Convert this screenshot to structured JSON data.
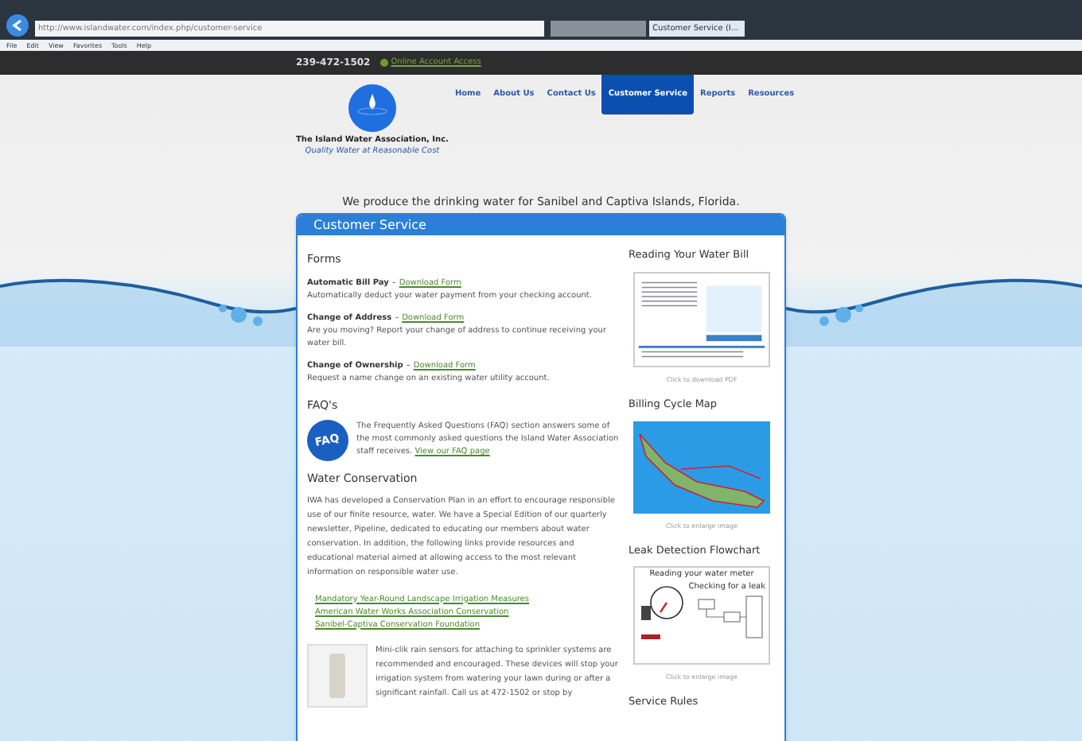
{
  "browser": {
    "url": "http://www.islandwater.com/index.php/customer-service",
    "tabs": [
      {
        "selected": false
      },
      {
        "label": "Customer Service (I...",
        "selected": true
      }
    ],
    "menu": [
      "File",
      "Edit",
      "View",
      "Favorites",
      "Tools",
      "Help"
    ]
  },
  "site": {
    "phone": "239-472-1502",
    "account_link": "Online Account Access",
    "logo": {
      "name": "The Island Water Association, Inc.",
      "tagline": "Quality Water at Reasonable Cost"
    },
    "nav": [
      {
        "label": "Home",
        "selected": false
      },
      {
        "label": "About Us",
        "selected": false
      },
      {
        "label": "Contact Us",
        "selected": false
      },
      {
        "label": "Customer Service",
        "selected": true
      },
      {
        "label": "Reports",
        "selected": false
      },
      {
        "label": "Resources",
        "selected": false
      }
    ],
    "tagline": "We produce the drinking water for Sanibel and Captiva Islands, Florida.",
    "panel_title": "Customer Service",
    "forms": {
      "heading": "Forms",
      "items": [
        {
          "title": "Automatic Bill Pay",
          "separator": "–",
          "link": "Download Form",
          "description": "Automatically deduct your water payment from your checking account."
        },
        {
          "title": "Change of Address",
          "separator": "–",
          "link": "Download Form",
          "description": "Are you moving? Report your change of address to continue receiving your water bill."
        },
        {
          "title": "Change of Ownership",
          "separator": "–",
          "link": "Download Form",
          "description": "Request a name change on an existing water utility account."
        }
      ]
    },
    "faq": {
      "heading": "FAQ's",
      "badge": "FAQ",
      "text": "The Frequently Asked Questions (FAQ) section answers some of the most commonly asked questions the Island Water Association staff receives.",
      "link": "View our FAQ page"
    },
    "conservation": {
      "heading": "Water Conservation",
      "text": "IWA has developed a Conservation Plan in an effort to encourage responsible use of our finite resource, water. We have a Special Edition of our quarterly newsletter, Pipeline, dedicated to educating our members about water conservation. In addition, the following links provide resources and educational material aimed at allowing access to the most relevant information on responsible water use.",
      "links": [
        "Mandatory Year-Round Landscape Irrigation Measures",
        "American Water Works Association Conservation",
        "Sanibel-Captiva Conservation Foundation"
      ],
      "product_text": "Mini-clik rain sensors for attaching to sprinkler systems are recommended and encouraged. These devices will stop your irrigation system from watering your lawn during or after a significant rainfall. Call us at 472-1502 or stop by"
    },
    "sidebar": [
      {
        "kind": "bill",
        "heading": "Reading Your Water Bill",
        "caption": "Click to download PDF"
      },
      {
        "kind": "map",
        "heading": "Billing Cycle Map",
        "caption": "Click to enlarge image"
      },
      {
        "kind": "flowchart",
        "heading": "Leak Detection Flowchart",
        "caption": "Click to enlarge image",
        "image_title": "Reading your water meter",
        "image_note": "Checking for a leak"
      },
      {
        "kind": "none",
        "heading": "Service Rules"
      }
    ]
  }
}
